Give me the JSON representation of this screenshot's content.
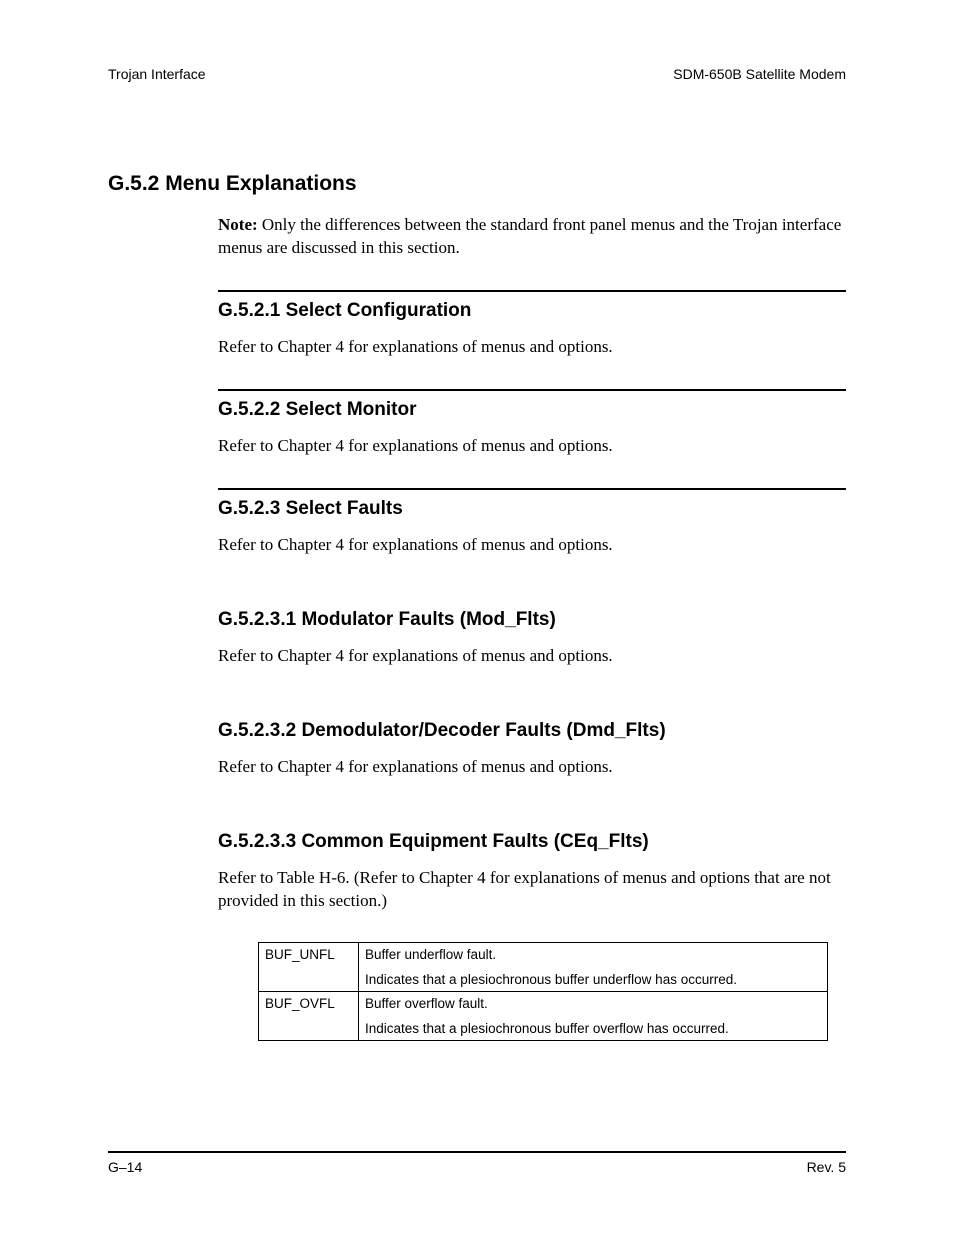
{
  "header": {
    "left": "Trojan Interface",
    "right": "SDM-650B Satellite Modem"
  },
  "sections": {
    "g52": {
      "heading": "G.5.2  Menu Explanations",
      "note_label": "Note:",
      "note_text": " Only the differences between the standard front panel menus and the Trojan interface menus are discussed in this section."
    },
    "g521": {
      "heading": "G.5.2.1  Select Configuration",
      "text": "Refer to Chapter 4 for explanations of menus and options."
    },
    "g522": {
      "heading": "G.5.2.2  Select Monitor",
      "text": "Refer to Chapter 4 for explanations of menus and options."
    },
    "g523": {
      "heading": "G.5.2.3  Select Faults",
      "text": "Refer to Chapter 4 for explanations of menus and options."
    },
    "g5231": {
      "heading": "G.5.2.3.1  Modulator Faults (Mod_Flts)",
      "text": "Refer to Chapter 4 for explanations of menus and options."
    },
    "g5232": {
      "heading": "G.5.2.3.2  Demodulator/Decoder Faults (Dmd_Flts)",
      "text": "Refer to Chapter 4 for explanations of menus and options."
    },
    "g5233": {
      "heading": "G.5.2.3.3  Common Equipment Faults (CEq_Flts)",
      "text": "Refer to Table H-6. (Refer to Chapter 4 for explanations of menus and options that are not provided in this section.)"
    }
  },
  "table": {
    "rows": [
      {
        "code": "BUF_UNFL",
        "line1": "Buffer underflow fault.",
        "line2": "Indicates that a plesiochronous buffer underflow has occurred."
      },
      {
        "code": "BUF_OVFL",
        "line1": "Buffer overflow fault.",
        "line2": "Indicates that a plesiochronous buffer overflow has occurred."
      }
    ]
  },
  "footer": {
    "left": "G–14",
    "right": "Rev. 5"
  }
}
